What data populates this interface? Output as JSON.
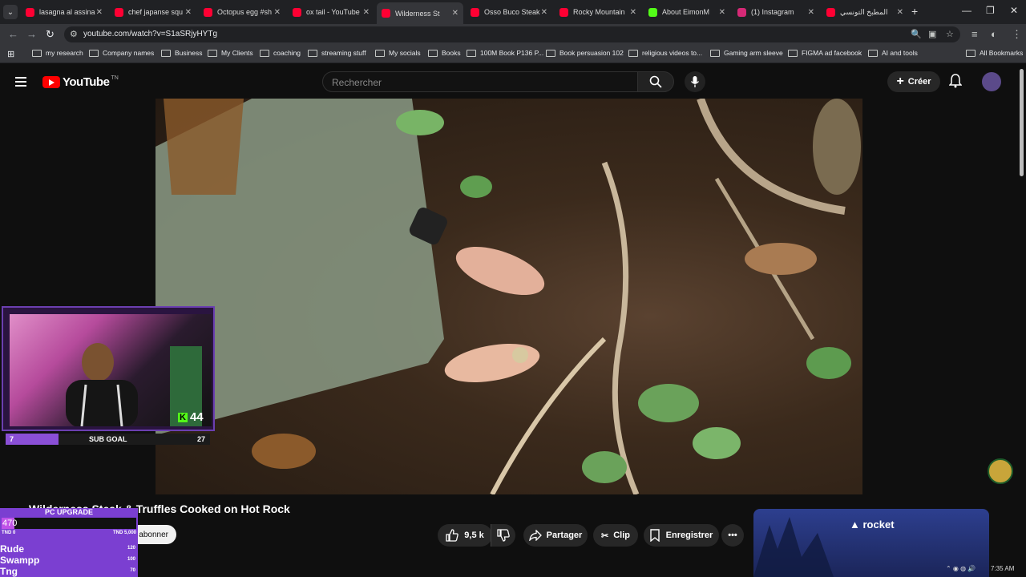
{
  "browser": {
    "tabs": [
      {
        "title": "lasagna al assina",
        "color": "#ff0033"
      },
      {
        "title": "chef japanse squ",
        "color": "#ff0033"
      },
      {
        "title": "Octopus egg #sh",
        "color": "#ff0033"
      },
      {
        "title": "ox tail - YouTube",
        "color": "#ff0033"
      },
      {
        "title": "Wilderness St",
        "color": "#ff0033"
      },
      {
        "title": "Osso Buco Steak",
        "color": "#ff0033"
      },
      {
        "title": "Rocky Mountain",
        "color": "#ff0033"
      },
      {
        "title": "About EimonM",
        "color": "#53fc18"
      },
      {
        "title": "(1) Instagram",
        "color": "#d62976"
      },
      {
        "title": "المطبخ التونسي",
        "color": "#ff0033"
      }
    ],
    "url": "youtube.com/watch?v=S1aSRjyHYTg",
    "bookmarks": [
      "my research",
      "Company names",
      "Business",
      "My Clients",
      "coaching",
      "streaming stuff",
      "My socials",
      "Books",
      "100M Book P136 P...",
      "Book persuasion 102",
      "religious videos to...",
      "Gaming arm sleeve",
      "FIGMA ad facebook",
      "AI and tools",
      "All Bookmarks"
    ]
  },
  "youtube": {
    "logo": "YouTube",
    "country": "TN",
    "search_placeholder": "Rechercher",
    "create_label": "Créer",
    "video_title": "Wilderness Steak & Truffles Cooked on Hot Rock",
    "subscribe_label": "abonner",
    "likes": "9,5 k",
    "share_label": "Partager",
    "clip_label": "Clip",
    "save_label": "Enregistrer",
    "ad_brand": "rocket"
  },
  "stream_overlay": {
    "sub_goal_label": "SUB GOAL",
    "sub_goal_current": "7",
    "sub_goal_target": "27",
    "sub_goal_progress": 0.26,
    "kick_count": "44",
    "pc_upgrade_title": "PC UPGRADE",
    "pc_upgrade_value": "470",
    "pc_range_min": "TND 0",
    "pc_range_max": "TND 5,000",
    "leaderboard": [
      {
        "name": "Rude",
        "score": "120"
      },
      {
        "name": "Swampp",
        "score": "100"
      },
      {
        "name": "Tng",
        "score": "70"
      }
    ]
  },
  "system": {
    "time": "7:35 AM"
  }
}
